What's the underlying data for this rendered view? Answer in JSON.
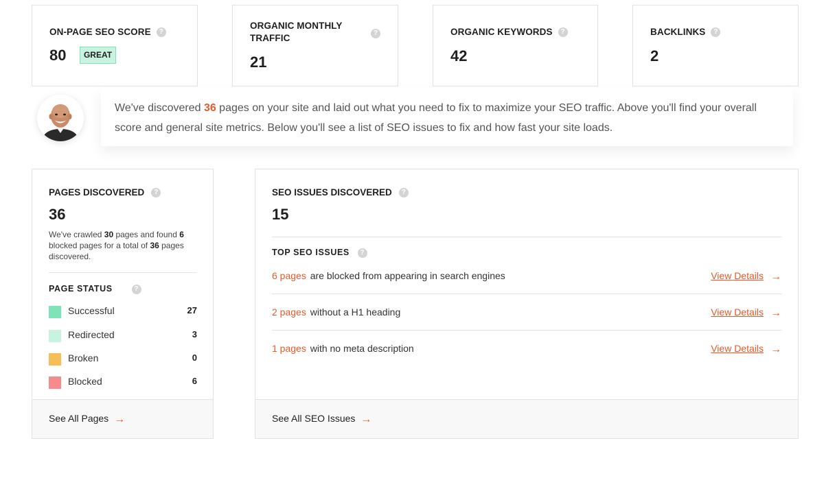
{
  "metrics": [
    {
      "label": "ON-PAGE SEO SCORE",
      "value": "80",
      "badge": "GREAT"
    },
    {
      "label_line1": "ORGANIC MONTHLY",
      "label_line2": "TRAFFIC",
      "value": "21"
    },
    {
      "label": "ORGANIC KEYWORDS",
      "value": "42"
    },
    {
      "label": "BACKLINKS",
      "value": "2"
    }
  ],
  "help_glyph": "?",
  "callout": {
    "pre": "We've discovered ",
    "count": "36",
    "post": " pages on your site and laid out what you need to fix to maximize your SEO traffic. Above you'll find your overall score and general site metrics. Below you'll see a list of SEO issues to fix and how fast your site loads."
  },
  "pages": {
    "title": "PAGES DISCOVERED",
    "value": "36",
    "desc_1": "We've crawled ",
    "crawled": "30",
    "desc_2": " pages and found ",
    "blocked": "6",
    "desc_3": " blocked pages for a total of ",
    "total": "36",
    "desc_4": " pages discovered.",
    "status_title": "PAGE STATUS",
    "statuses": [
      {
        "name": "Successful",
        "count": "27",
        "color": "#7fe3b8"
      },
      {
        "name": "Redirected",
        "count": "3",
        "color": "#c9f3e1"
      },
      {
        "name": "Broken",
        "count": "0",
        "color": "#f9bd57"
      },
      {
        "name": "Blocked",
        "count": "6",
        "color": "#f68b8b"
      }
    ],
    "footer": "See All Pages"
  },
  "issues": {
    "title": "SEO ISSUES DISCOVERED",
    "value": "15",
    "top_title": "TOP SEO ISSUES",
    "items": [
      {
        "count": "6 pages",
        "text": "are blocked from appearing in search engines",
        "link": "View Details"
      },
      {
        "count": "2 pages",
        "text": "without a H1 heading",
        "link": "View Details"
      },
      {
        "count": "1 pages",
        "text": "with no meta description",
        "link": "View Details"
      }
    ],
    "footer": "See All SEO Issues"
  },
  "arrow_glyph": "→",
  "accent_color": "#e45a2b"
}
